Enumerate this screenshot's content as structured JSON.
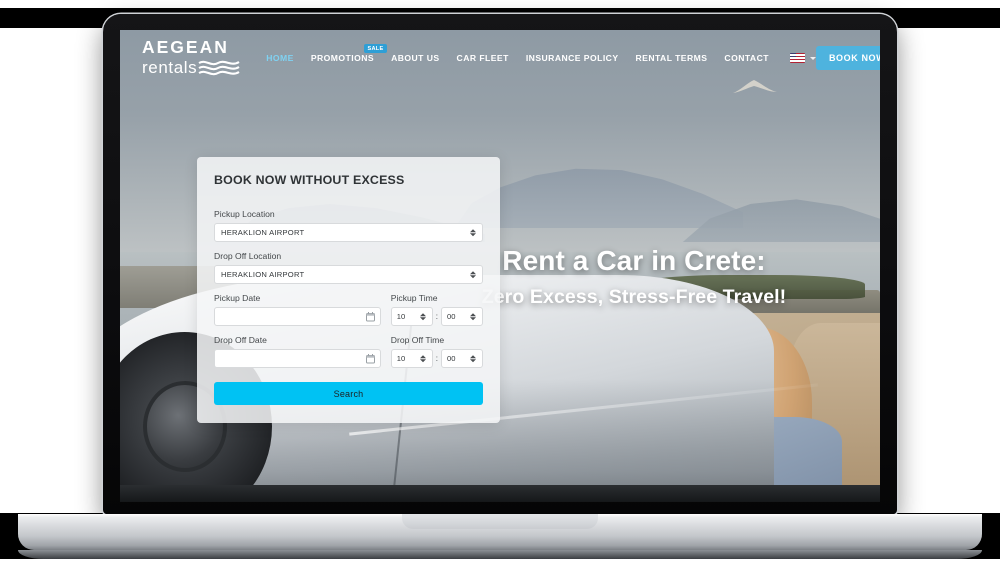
{
  "site": {
    "logo_top": "AEGEAN",
    "logo_bottom": "rentals",
    "logo_wave_icon": "waves-icon"
  },
  "nav": {
    "items": [
      {
        "label": "HOME",
        "active": true,
        "badge": null
      },
      {
        "label": "PROMOTIONS",
        "active": false,
        "badge": "SALE"
      },
      {
        "label": "ABOUT US",
        "active": false,
        "badge": null
      },
      {
        "label": "CAR FLEET",
        "active": false,
        "badge": null
      },
      {
        "label": "INSURANCE POLICY",
        "active": false,
        "badge": null
      },
      {
        "label": "RENTAL TERMS",
        "active": false,
        "badge": null
      },
      {
        "label": "CONTACT",
        "active": false,
        "badge": null
      }
    ],
    "language": {
      "flag": "us-flag-icon",
      "chevron": "chevron-down-icon"
    },
    "book_now_label": "BOOK NOW"
  },
  "booking": {
    "title": "BOOK NOW WITHOUT EXCESS",
    "pickup_location": {
      "label": "Pickup Location",
      "value": "HERAKLION AIRPORT"
    },
    "dropoff_location": {
      "label": "Drop Off Location",
      "value": "HERAKLION AIRPORT"
    },
    "pickup_date": {
      "label": "Pickup Date",
      "value": "",
      "placeholder": ""
    },
    "dropoff_date": {
      "label": "Drop Off Date",
      "value": "",
      "placeholder": ""
    },
    "pickup_time": {
      "label": "Pickup Time",
      "hour": "10",
      "minute": "00",
      "separator": ":"
    },
    "dropoff_time": {
      "label": "Drop Off Time",
      "hour": "10",
      "minute": "00",
      "separator": ":"
    },
    "search_label": "Search",
    "calendar_icon": "calendar-icon"
  },
  "hero": {
    "line1": "Rent a Car in Crete:",
    "line2": "Zero Excess, Stress-Free Travel!"
  },
  "colors": {
    "accent_cyan": "#00c2f3",
    "nav_button_blue": "#4eb3de",
    "active_link_blue": "#7fd2f2",
    "badge_blue": "#2e9fd6",
    "panel_bg": "#f5f6f7"
  }
}
